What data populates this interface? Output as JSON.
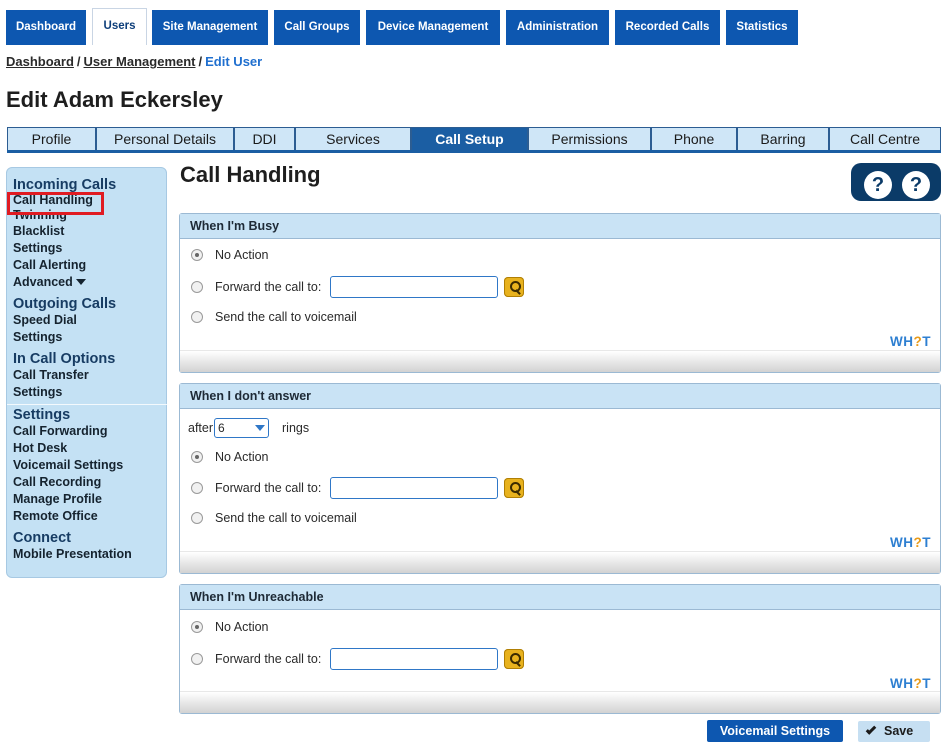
{
  "topnav": [
    {
      "label": "Dashboard",
      "active": false
    },
    {
      "label": "Users",
      "active": true
    },
    {
      "label": "Site Management",
      "active": false
    },
    {
      "label": "Call Groups",
      "active": false
    },
    {
      "label": "Device Management",
      "active": false
    },
    {
      "label": "Administration",
      "active": false
    },
    {
      "label": "Recorded Calls",
      "active": false
    },
    {
      "label": "Statistics",
      "active": false
    }
  ],
  "breadcrumb": {
    "dashboard": "Dashboard",
    "sep1": "/",
    "user_management": "User Management",
    "sep2": "/",
    "current": "Edit User"
  },
  "page_title": "Edit Adam Eckersley",
  "subtabs": [
    {
      "label": "Profile"
    },
    {
      "label": "Personal Details"
    },
    {
      "label": "DDI"
    },
    {
      "label": "Services"
    },
    {
      "label": "Call Setup",
      "active": true
    },
    {
      "label": "Permissions"
    },
    {
      "label": "Phone"
    },
    {
      "label": "Barring"
    },
    {
      "label": "Call Centre"
    }
  ],
  "sidebar": {
    "incoming": "Incoming Calls",
    "call_handling": "Call Handling",
    "twinning": "Twinning",
    "blacklist": "Blacklist",
    "settings1": "Settings",
    "call_alerting": "Call Alerting",
    "advanced": "Advanced",
    "outgoing": "Outgoing Calls",
    "speed_dial": "Speed Dial",
    "settings2": "Settings",
    "in_call": "In Call Options",
    "call_transfer": "Call Transfer",
    "settings3": "Settings",
    "settings_head": "Settings",
    "call_forwarding": "Call Forwarding",
    "hot_desk": "Hot Desk",
    "voicemail_settings": "Voicemail Settings",
    "call_recording": "Call Recording",
    "manage_profile": "Manage Profile",
    "remote_office": "Remote Office",
    "connect": "Connect",
    "mobile_presentation": "Mobile Presentation"
  },
  "main": {
    "title": "Call Handling",
    "help1": "?",
    "help2": "?",
    "whot": {
      "a": "WH",
      "q": "?",
      "b": "T"
    },
    "busy": {
      "header": "When I'm Busy",
      "no_action": "No Action",
      "forward": "Forward the call to:",
      "voicemail": "Send the call to voicemail",
      "forward_value": ""
    },
    "no_answer": {
      "header": "When I don't answer",
      "after": "after",
      "rings_value": "6",
      "rings": "rings",
      "no_action": "No Action",
      "forward": "Forward the call to:",
      "voicemail": "Send the call to voicemail",
      "forward_value": ""
    },
    "unreachable": {
      "header": "When I'm Unreachable",
      "no_action": "No Action",
      "forward": "Forward the call to:",
      "forward_value": ""
    }
  },
  "buttons": {
    "voicemail_settings": "Voicemail Settings",
    "save": "Save"
  }
}
